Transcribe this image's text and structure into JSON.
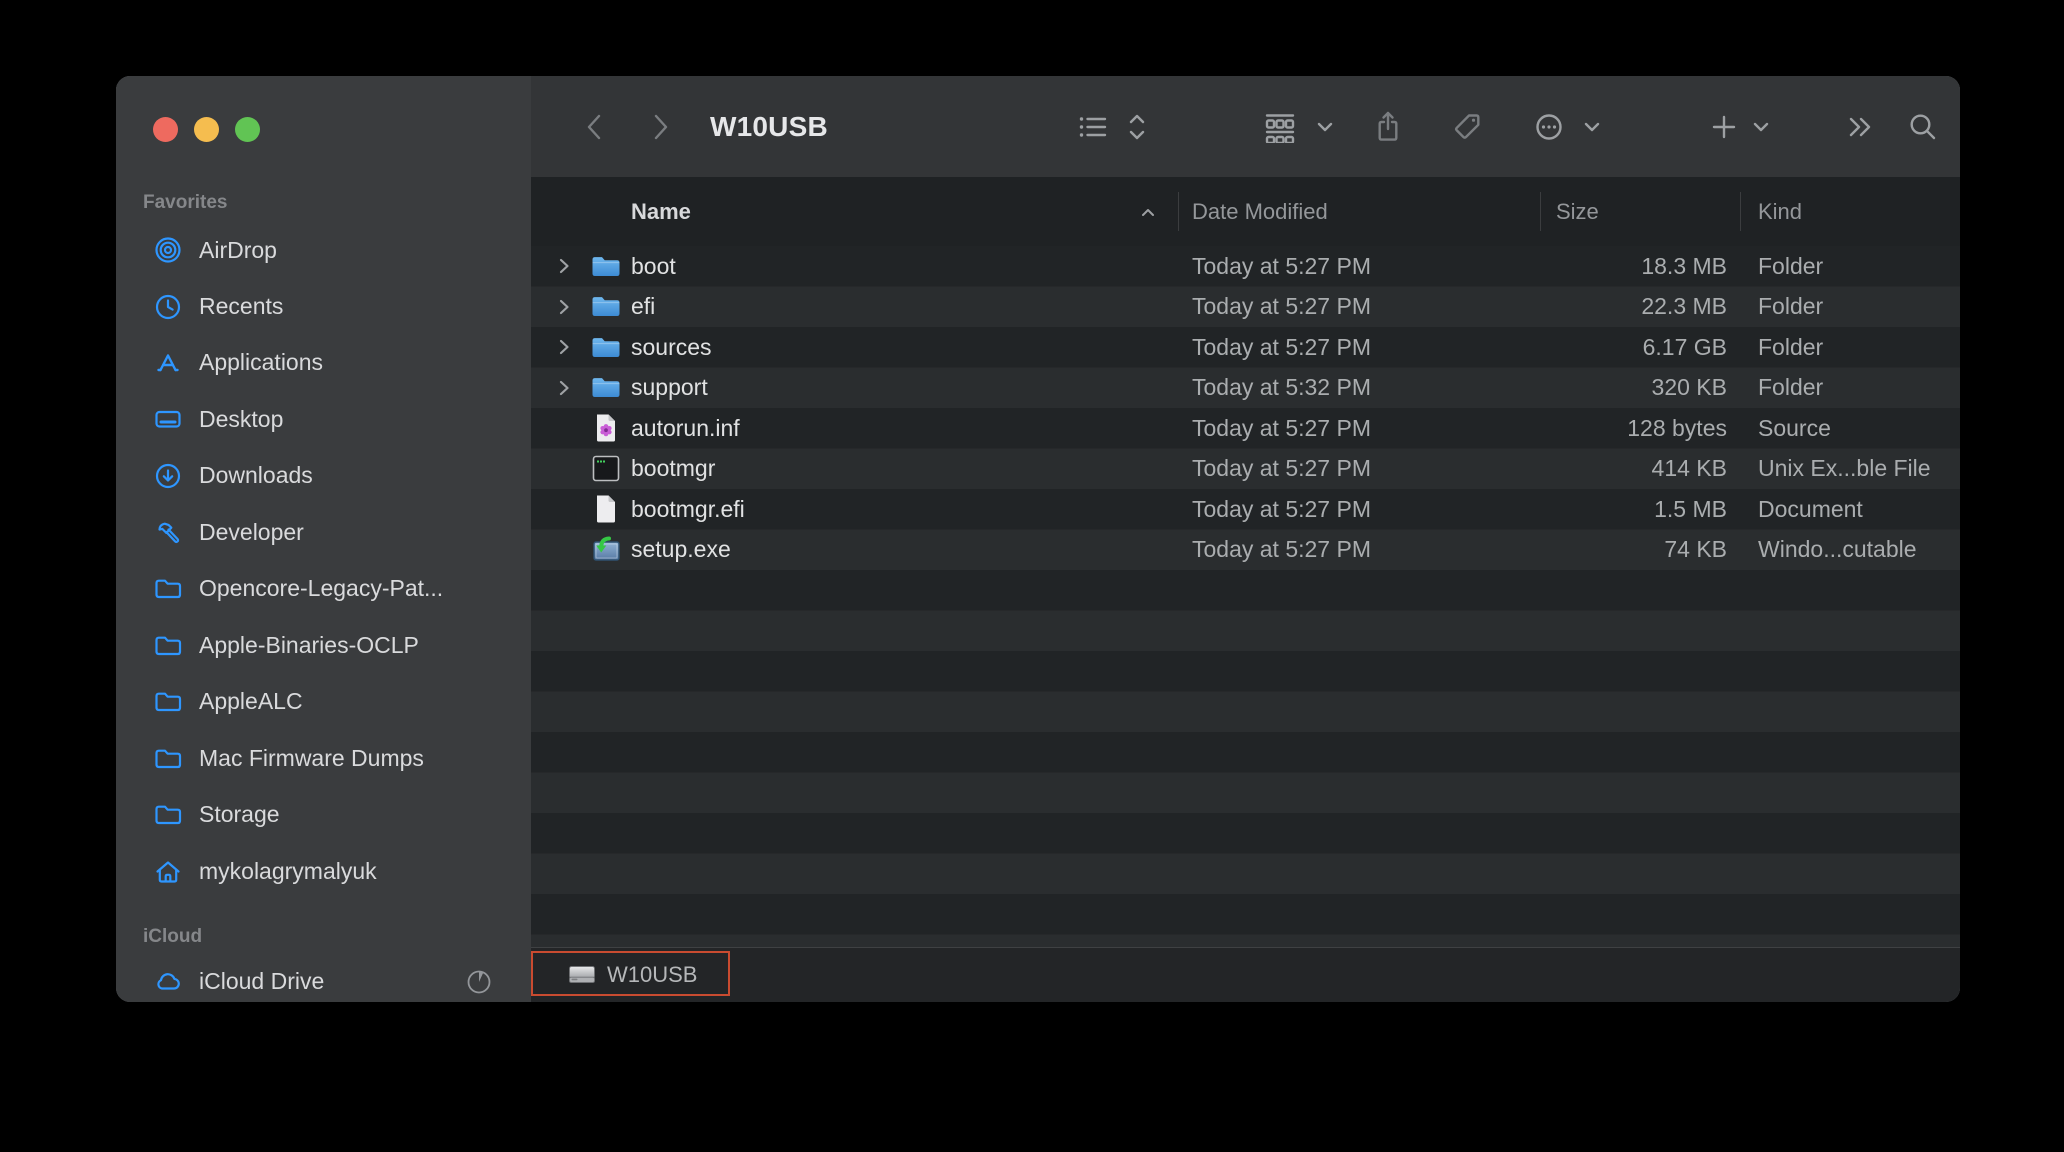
{
  "window": {
    "title": "W10USB"
  },
  "toolbar": {
    "title": "W10USB",
    "icons": [
      "back",
      "forward",
      "list-view",
      "sort-stepper",
      "group-by",
      "share",
      "tag",
      "more-actions",
      "add",
      "overflow",
      "search"
    ]
  },
  "sidebar": {
    "sections": [
      {
        "label": "Favorites",
        "items": [
          {
            "label": "AirDrop",
            "icon": "airdrop"
          },
          {
            "label": "Recents",
            "icon": "clock"
          },
          {
            "label": "Applications",
            "icon": "app-store-a"
          },
          {
            "label": "Desktop",
            "icon": "desktop"
          },
          {
            "label": "Downloads",
            "icon": "download-circle"
          },
          {
            "label": "Developer",
            "icon": "hammer"
          },
          {
            "label": "Opencore-Legacy-Pat...",
            "icon": "folder"
          },
          {
            "label": "Apple-Binaries-OCLP",
            "icon": "folder"
          },
          {
            "label": "AppleALC",
            "icon": "folder"
          },
          {
            "label": "Mac Firmware Dumps",
            "icon": "folder"
          },
          {
            "label": "Storage",
            "icon": "folder"
          },
          {
            "label": "mykolagrymalyuk",
            "icon": "home"
          }
        ]
      },
      {
        "label": "iCloud",
        "items": [
          {
            "label": "iCloud Drive",
            "icon": "cloud",
            "trailing_icon": "progress-pie"
          }
        ]
      }
    ]
  },
  "list": {
    "columns": [
      {
        "label": "Name",
        "sort": "ascending"
      },
      {
        "label": "Date Modified"
      },
      {
        "label": "Size"
      },
      {
        "label": "Kind"
      }
    ],
    "rows": [
      {
        "name": "boot",
        "icon": "folder",
        "expandable": true,
        "date_modified": "Today at 5:27 PM",
        "size": "18.3 MB",
        "kind": "Folder"
      },
      {
        "name": "efi",
        "icon": "folder",
        "expandable": true,
        "date_modified": "Today at 5:27 PM",
        "size": "22.3 MB",
        "kind": "Folder"
      },
      {
        "name": "sources",
        "icon": "folder",
        "expandable": true,
        "date_modified": "Today at 5:27 PM",
        "size": "6.17 GB",
        "kind": "Folder"
      },
      {
        "name": "support",
        "icon": "folder",
        "expandable": true,
        "date_modified": "Today at 5:32 PM",
        "size": "320 KB",
        "kind": "Folder"
      },
      {
        "name": "autorun.inf",
        "icon": "inf-source-file",
        "expandable": false,
        "date_modified": "Today at 5:27 PM",
        "size": "128 bytes",
        "kind": "Source"
      },
      {
        "name": "bootmgr",
        "icon": "unix-executable",
        "expandable": false,
        "date_modified": "Today at 5:27 PM",
        "size": "414 KB",
        "kind": "Unix Ex...ble File"
      },
      {
        "name": "bootmgr.efi",
        "icon": "document",
        "expandable": false,
        "date_modified": "Today at 5:27 PM",
        "size": "1.5 MB",
        "kind": "Document"
      },
      {
        "name": "setup.exe",
        "icon": "windows-executable",
        "expandable": false,
        "date_modified": "Today at 5:27 PM",
        "size": "74 KB",
        "kind": "Windo...cutable"
      }
    ]
  },
  "statusbar": {
    "volume_label": "W10USB"
  },
  "colors": {
    "accent_blue": "#2e96ff",
    "traffic_close": "#ee6a5f",
    "traffic_minimize": "#f5bd4f",
    "traffic_zoom": "#61c454",
    "highlight_outline": "#c94b30"
  }
}
